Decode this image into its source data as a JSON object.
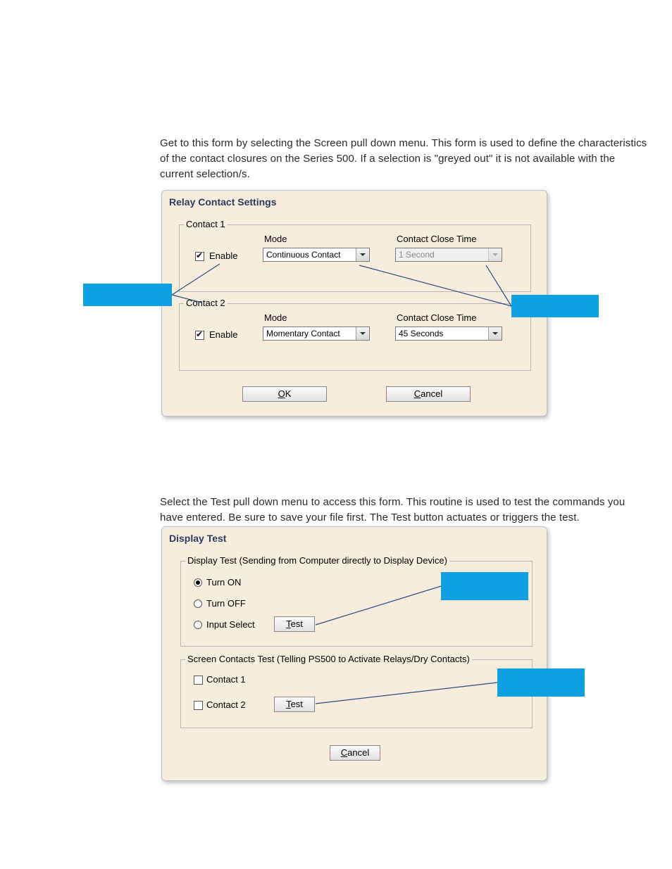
{
  "para1": "Get to this form by selecting the Screen pull down menu. This form is used to define the characteristics of the contact closures on the Series 500. If a selection is \"greyed out\" it is not available with the current selection/s.",
  "para2": "Select the Test pull down menu to access this form. This routine is used to test the commands you have entered. Be sure to save your file first. The Test button actuates or triggers the test.",
  "relay": {
    "title": "Relay Contact Settings",
    "contact1": {
      "legend": "Contact 1",
      "enable_label": "Enable",
      "enable_checked": true,
      "mode_label": "Mode",
      "mode_value": "Continuous Contact",
      "close_label": "Contact Close Time",
      "close_value": "1 Second",
      "close_disabled": true
    },
    "contact2": {
      "legend": "Contact 2",
      "enable_label": "Enable",
      "enable_checked": true,
      "mode_label": "Mode",
      "mode_value": "Momentary Contact",
      "close_label": "Contact Close Time",
      "close_value": "45 Seconds",
      "close_disabled": false
    },
    "ok_label_prefix": "O",
    "ok_label_rest": "K",
    "cancel_label_prefix": "C",
    "cancel_label_rest": "ancel"
  },
  "test": {
    "title": "Display Test",
    "group1": {
      "legend": "Display Test (Sending from Computer directly to Display Device)",
      "opt_on": "Turn ON",
      "opt_off": "Turn OFF",
      "opt_input": "Input Select",
      "test_label_prefix": "T",
      "test_label_rest": "est"
    },
    "group2": {
      "legend": "Screen Contacts Test (Telling PS500 to Activate Relays/Dry Contacts)",
      "chk1": "Contact 1",
      "chk2": "Contact 2",
      "test_label_prefix": "T",
      "test_label_rest": "est"
    },
    "cancel_label_prefix": "C",
    "cancel_label_rest": "ancel"
  }
}
